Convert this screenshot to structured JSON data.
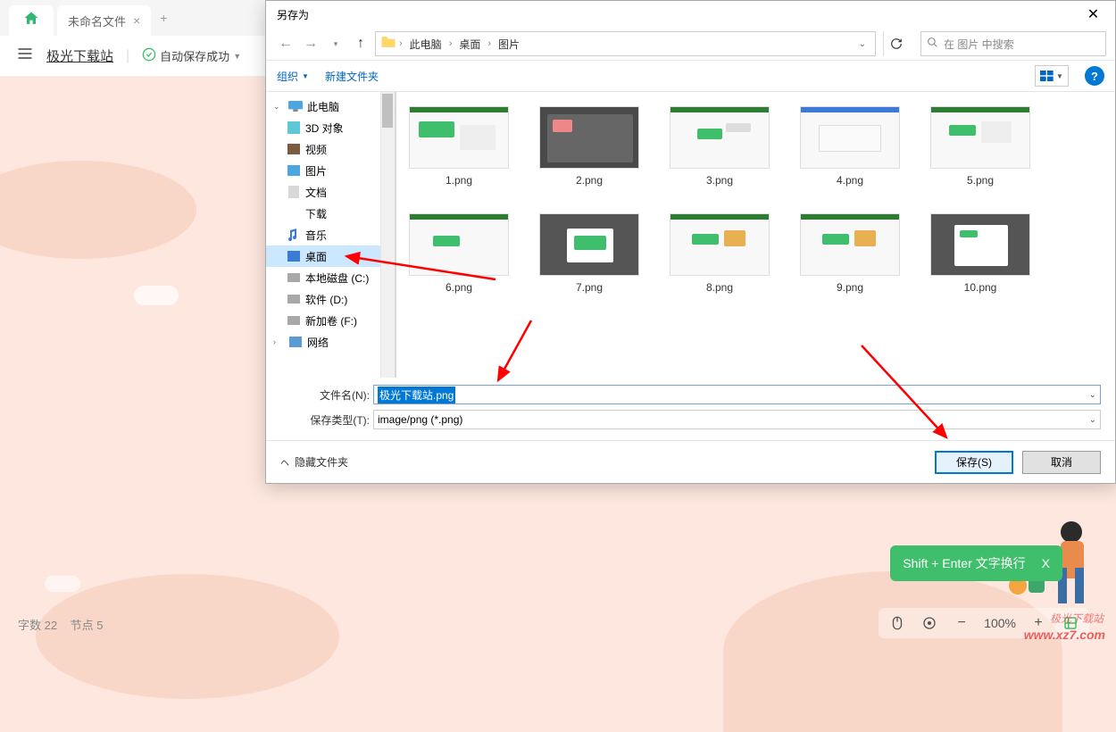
{
  "app": {
    "tab_title": "未命名文件",
    "doc_title": "极光下载站",
    "autosave": "自动保存成功",
    "status_chars_label": "字数",
    "status_chars_value": "22",
    "status_nodes_label": "节点",
    "status_nodes_value": "5",
    "zoom": "100%",
    "hint": "Shift + Enter 文字换行",
    "hint_close": "X"
  },
  "dialog": {
    "title": "另存为",
    "path": {
      "seg1": "此电脑",
      "seg2": "桌面",
      "seg3": "图片"
    },
    "search_placeholder": "在 图片 中搜索",
    "organize": "组织",
    "new_folder": "新建文件夹",
    "hide_folders": "隐藏文件夹",
    "save_btn": "保存(S)",
    "cancel_btn": "取消",
    "filename_label": "文件名(N):",
    "filename_value": "极光下载站.png",
    "filetype_label": "保存类型(T):",
    "filetype_value": "image/png (*.png)"
  },
  "tree": {
    "this_pc": "此电脑",
    "obj3d": "3D 对象",
    "videos": "视频",
    "pictures": "图片",
    "documents": "文档",
    "downloads": "下载",
    "music": "音乐",
    "desktop": "桌面",
    "local_disk": "本地磁盘 (C:)",
    "soft_disk": "软件 (D:)",
    "new_vol": "新加卷 (F:)",
    "network": "网络"
  },
  "files": [
    {
      "name": "1.png"
    },
    {
      "name": "2.png"
    },
    {
      "name": "3.png"
    },
    {
      "name": "4.png"
    },
    {
      "name": "5.png"
    },
    {
      "name": "6.png"
    },
    {
      "name": "7.png"
    },
    {
      "name": "8.png"
    },
    {
      "name": "9.png"
    },
    {
      "name": "10.png"
    }
  ],
  "watermark": {
    "brand": "极光下载站",
    "url": "www.xz7.com"
  }
}
